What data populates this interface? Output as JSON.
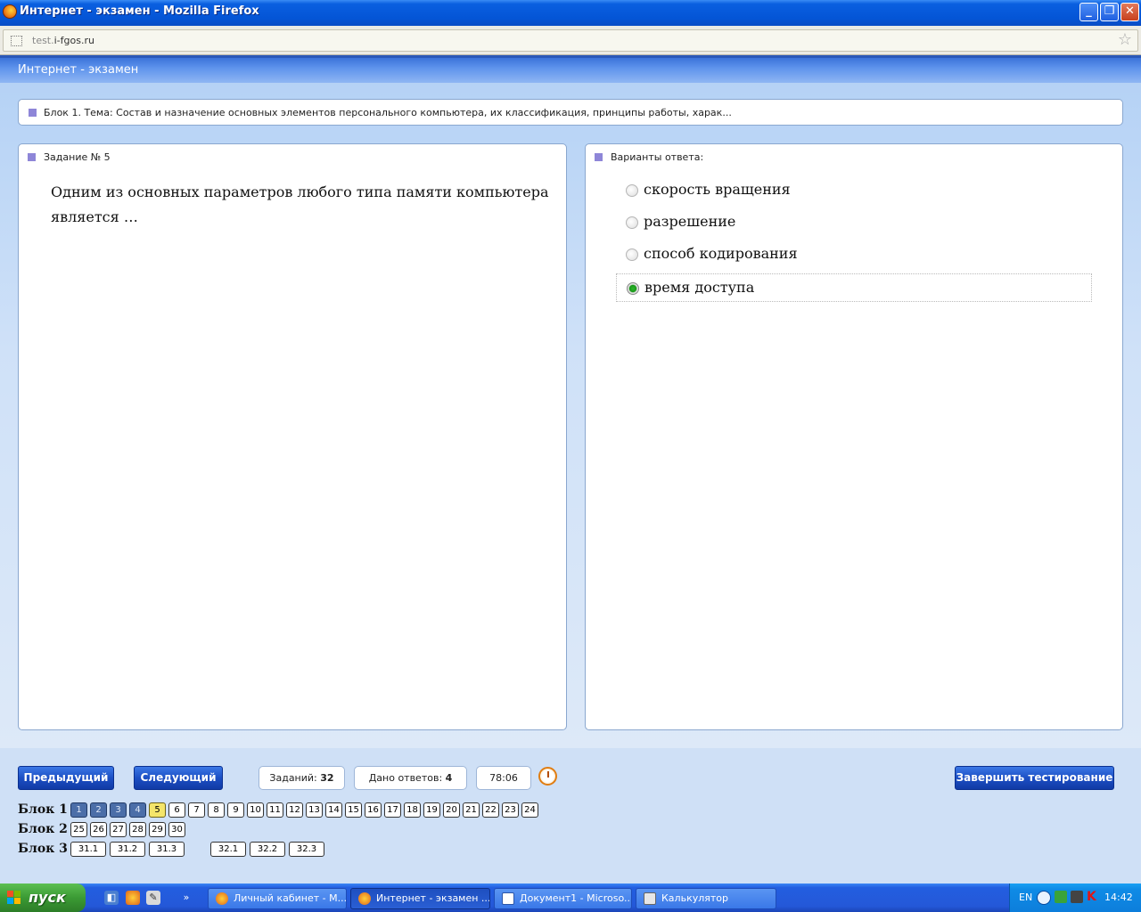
{
  "window": {
    "title": "Интернет - экзамен - Mozilla Firefox",
    "min_glyph": "_",
    "max_glyph": "❐",
    "close_glyph": "✕"
  },
  "browser": {
    "url_prefix": "test.",
    "url_host": "i-fgos.ru",
    "bookmark_glyph": "☆"
  },
  "app": {
    "name": "Интернет - экзамен"
  },
  "topic": "Блок 1. Тема: Состав и назначение основных элементов персонального компьютера, их классификация, принципы работы, харак...",
  "task": {
    "heading": "Задание № 5",
    "text": "Одним из основных параметров любого типа памяти компьютера является …"
  },
  "answers": {
    "heading": "Варианты ответа:",
    "options": [
      {
        "label": "скорость вращения",
        "selected": false
      },
      {
        "label": "разрешение",
        "selected": false
      },
      {
        "label": "способ кодирования",
        "selected": false
      },
      {
        "label": "время доступа",
        "selected": true
      }
    ]
  },
  "controls": {
    "prev": "Предыдущий",
    "next": "Следующий",
    "tasks_label": "Заданий:",
    "tasks_count": "32",
    "answered_label": "Дано ответов:",
    "answered_count": "4",
    "timer": "78:06",
    "finish": "Завершить тестирование"
  },
  "blocks": [
    {
      "label": "Блок 1",
      "items": [
        {
          "n": "1",
          "state": "done"
        },
        {
          "n": "2",
          "state": "done"
        },
        {
          "n": "3",
          "state": "done"
        },
        {
          "n": "4",
          "state": "done"
        },
        {
          "n": "5",
          "state": "current"
        },
        {
          "n": "6",
          "state": "empty"
        },
        {
          "n": "7",
          "state": "empty"
        },
        {
          "n": "8",
          "state": "empty"
        },
        {
          "n": "9",
          "state": "empty"
        },
        {
          "n": "10",
          "state": "empty"
        },
        {
          "n": "11",
          "state": "empty"
        },
        {
          "n": "12",
          "state": "empty"
        },
        {
          "n": "13",
          "state": "empty"
        },
        {
          "n": "14",
          "state": "empty"
        },
        {
          "n": "15",
          "state": "empty"
        },
        {
          "n": "16",
          "state": "empty"
        },
        {
          "n": "17",
          "state": "empty"
        },
        {
          "n": "18",
          "state": "empty"
        },
        {
          "n": "19",
          "state": "empty"
        },
        {
          "n": "20",
          "state": "empty"
        },
        {
          "n": "21",
          "state": "empty"
        },
        {
          "n": "22",
          "state": "empty"
        },
        {
          "n": "23",
          "state": "empty"
        },
        {
          "n": "24",
          "state": "empty"
        }
      ]
    },
    {
      "label": "Блок 2",
      "items": [
        {
          "n": "25",
          "state": "empty"
        },
        {
          "n": "26",
          "state": "empty"
        },
        {
          "n": "27",
          "state": "empty"
        },
        {
          "n": "28",
          "state": "empty"
        },
        {
          "n": "29",
          "state": "empty"
        },
        {
          "n": "30",
          "state": "empty"
        }
      ]
    },
    {
      "label": "Блок 3",
      "items": [
        {
          "n": "31.1",
          "state": "empty"
        },
        {
          "n": "31.2",
          "state": "empty"
        },
        {
          "n": "31.3",
          "state": "empty"
        },
        {
          "n": "32.1",
          "state": "empty"
        },
        {
          "n": "32.2",
          "state": "empty"
        },
        {
          "n": "32.3",
          "state": "empty"
        }
      ]
    }
  ],
  "taskbar": {
    "start": "пуск",
    "ql_overflow": "»",
    "tasks": [
      {
        "label": "Личный кабинет - М...",
        "icon": "firefox-icon",
        "active": false
      },
      {
        "label": "Интернет - экзамен ...",
        "icon": "firefox-icon",
        "active": true
      },
      {
        "label": "Документ1 - Microso...",
        "icon": "word-icon",
        "active": false
      },
      {
        "label": "Калькулятор",
        "icon": "calculator-icon",
        "active": false
      }
    ],
    "lang": "EN",
    "time": "14:42"
  },
  "colors": {
    "done_cell": "#4b6ea8",
    "current_cell": "#f4e56a",
    "selected_radio": "#199819",
    "button_blue": "#1c4fc4"
  }
}
